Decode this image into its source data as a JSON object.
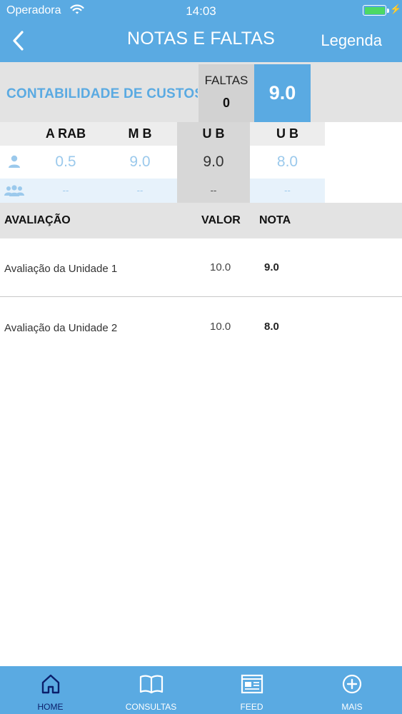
{
  "status_bar": {
    "carrier": "Operadora",
    "time": "14:03",
    "battery_color": "#4cd964"
  },
  "nav": {
    "title": "NOTAS E FALTAS",
    "legend_label": "Legenda",
    "back_icon": "chevron-left-icon"
  },
  "course": {
    "name": "CONTABILIDADE DE CUSTOS II",
    "faltas_label": "FALTAS",
    "faltas_value": "0",
    "average": "9.0"
  },
  "grades": {
    "columns": [
      "A RAB",
      "M B",
      "U B",
      "U B"
    ],
    "student_icon": "person-icon",
    "class_icon": "group-icon",
    "student_values": [
      "0.5",
      "9.0",
      "9.0",
      "8.0"
    ],
    "class_values": [
      "--",
      "--",
      "--",
      "--"
    ]
  },
  "assessments": {
    "headers": {
      "name": "AVALIAÇÃO",
      "valor": "VALOR",
      "nota": "NOTA"
    },
    "rows": [
      {
        "name": "Avaliação da Unidade 1",
        "valor": "10.0",
        "nota": "9.0"
      },
      {
        "name": "Avaliação da Unidade 2",
        "valor": "10.0",
        "nota": "8.0"
      }
    ]
  },
  "tabbar": {
    "items": [
      {
        "label": "HOME",
        "icon": "home-icon"
      },
      {
        "label": "CONSULTAS",
        "icon": "book-icon"
      },
      {
        "label": "FEED",
        "icon": "newspaper-icon"
      },
      {
        "label": "MAIS",
        "icon": "plus-circle-icon"
      }
    ],
    "active_index": 0
  },
  "colors": {
    "primary": "#5aaae2",
    "active_tab": "#0b1f6b",
    "light_value": "#9bc9ec"
  }
}
